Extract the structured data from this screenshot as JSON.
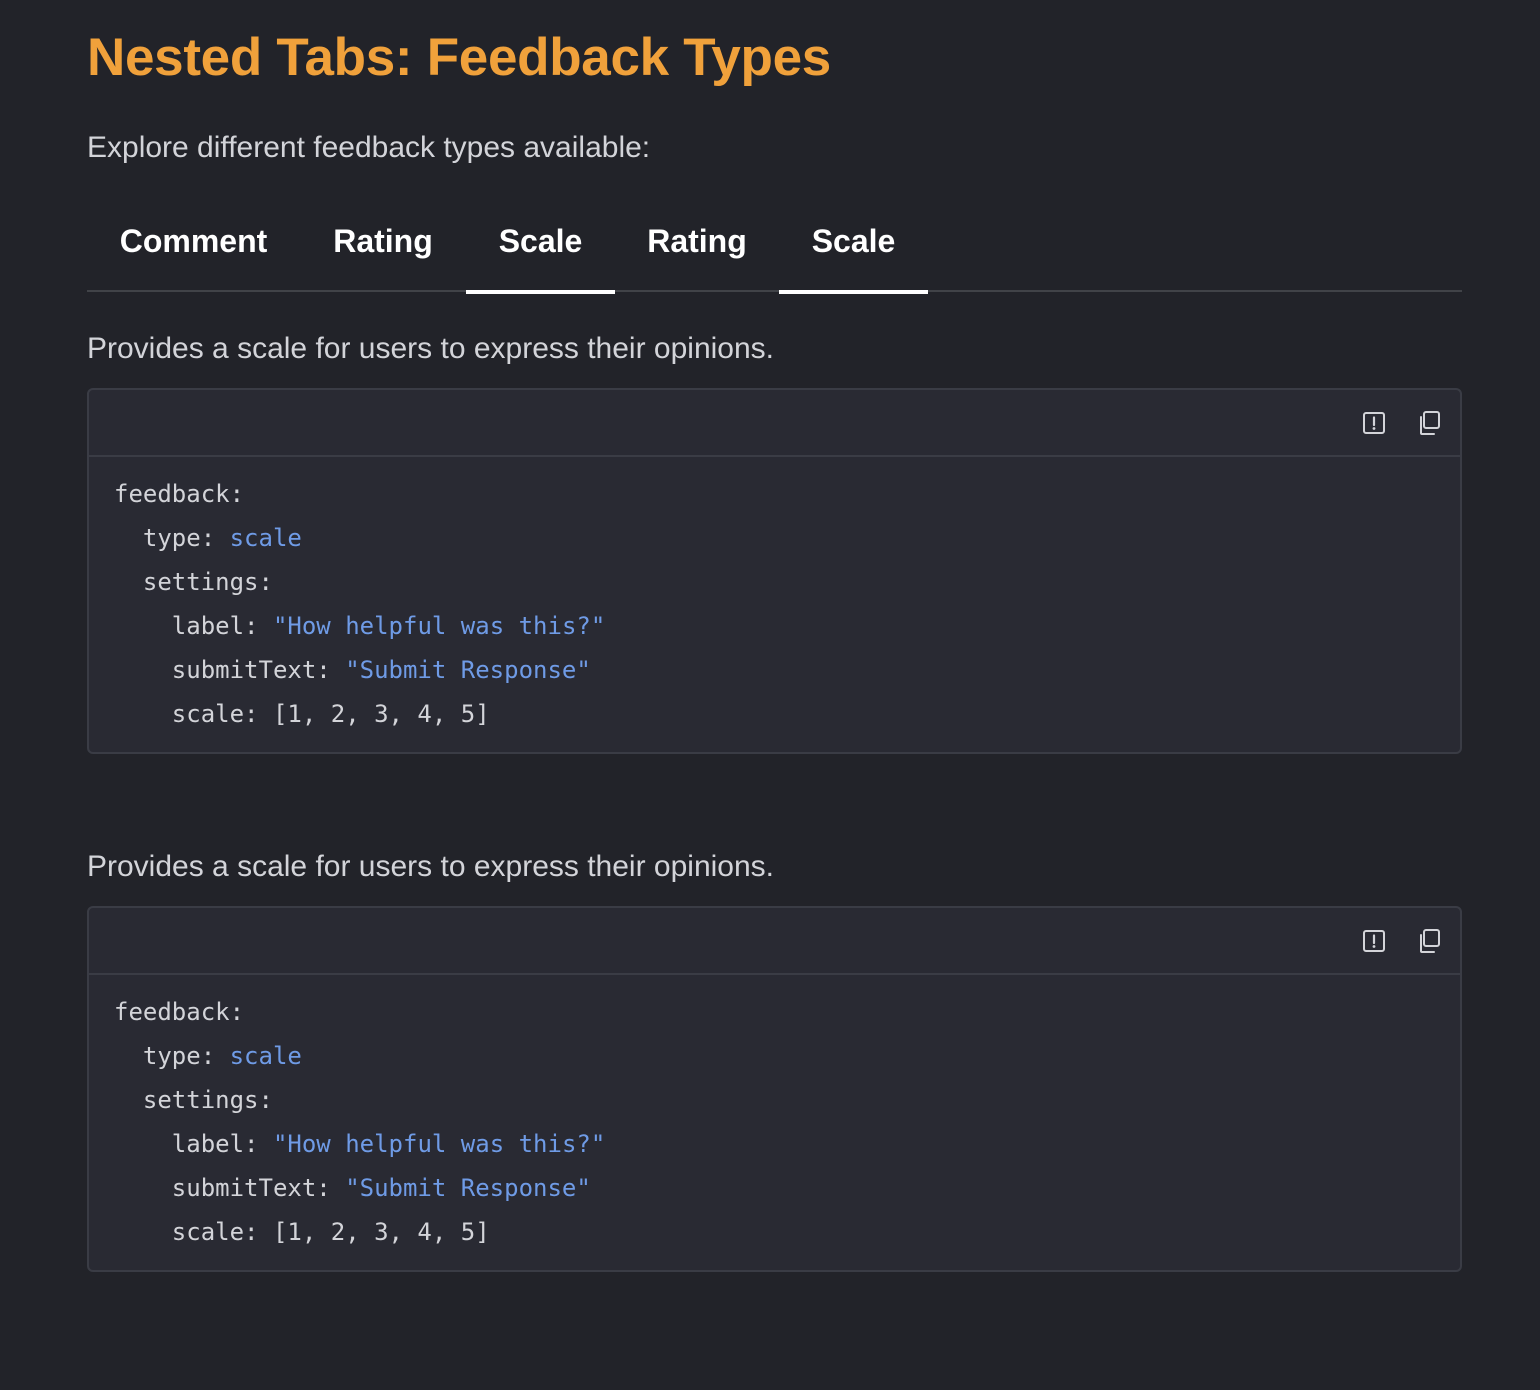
{
  "page": {
    "title": "Nested Tabs: Feedback Types",
    "intro": "Explore different feedback types available:"
  },
  "tabs": [
    {
      "label": "Comment",
      "active": false
    },
    {
      "label": "Rating",
      "active": false
    },
    {
      "label": "Scale",
      "active": true
    },
    {
      "label": "Rating",
      "active": false
    },
    {
      "label": "Scale",
      "active": true
    }
  ],
  "sections": [
    {
      "description": "Provides a scale for users to express their opinions.",
      "toolbar": {
        "report_icon": "report-issue-icon",
        "copy_icon": "copy-icon"
      },
      "code": {
        "line1_key": "feedback:",
        "line2_key": "  type: ",
        "line2_value": "scale",
        "line3_key": "  settings:",
        "line4_key": "    label: ",
        "line4_value": "\"How helpful was this?\"",
        "line5_key": "    submitText: ",
        "line5_value": "\"Submit Response\"",
        "line6_key": "    scale: [1, 2, 3, 4, 5]"
      }
    },
    {
      "description": "Provides a scale for users to express their opinions.",
      "toolbar": {
        "report_icon": "report-issue-icon",
        "copy_icon": "copy-icon"
      },
      "code": {
        "line1_key": "feedback:",
        "line2_key": "  type: ",
        "line2_value": "scale",
        "line3_key": "  settings:",
        "line4_key": "    label: ",
        "line4_value": "\"How helpful was this?\"",
        "line5_key": "    submitText: ",
        "line5_value": "\"Submit Response\"",
        "line6_key": "    scale: [1, 2, 3, 4, 5]"
      }
    }
  ],
  "colors": {
    "background": "#222329",
    "title": "#f0a13b",
    "code_background": "#292a33",
    "code_string": "#6f9be6",
    "tab_underline": "#ffffff"
  }
}
